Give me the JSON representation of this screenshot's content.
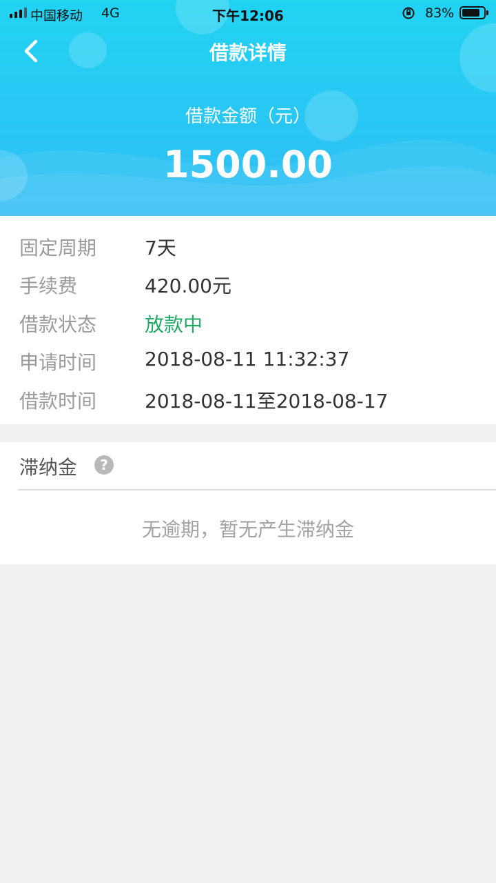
{
  "status_bar": {
    "carrier": "中国移动",
    "network": "4G",
    "time": "下午12:06",
    "battery": "83%",
    "battery_level": 0.83
  },
  "nav": {
    "title": "借款详情",
    "back_icon": "chevron-left-icon"
  },
  "hero": {
    "amount_label": "借款金额（元）",
    "amount_value": "1500.00"
  },
  "details": [
    {
      "label": "固定周期",
      "value": "7天"
    },
    {
      "label": "手续费",
      "value": "420.00元"
    },
    {
      "label": "借款状态",
      "value": "放款中",
      "color": "#21a866"
    },
    {
      "label": "申请时间",
      "value": "2018-08-11 11:32:37"
    },
    {
      "label": "借款时间",
      "value": "2018-08-11至2018-08-17"
    }
  ],
  "late_fee": {
    "title": "滞纳金",
    "help_icon": "?",
    "message": "无逾期，暂无产生滞纳金"
  },
  "colors": {
    "header_gradient_top": "#22d3f2",
    "header_gradient_bottom": "#34bdf5",
    "status_green": "#21a866",
    "page_background": "#f1f1f1"
  }
}
